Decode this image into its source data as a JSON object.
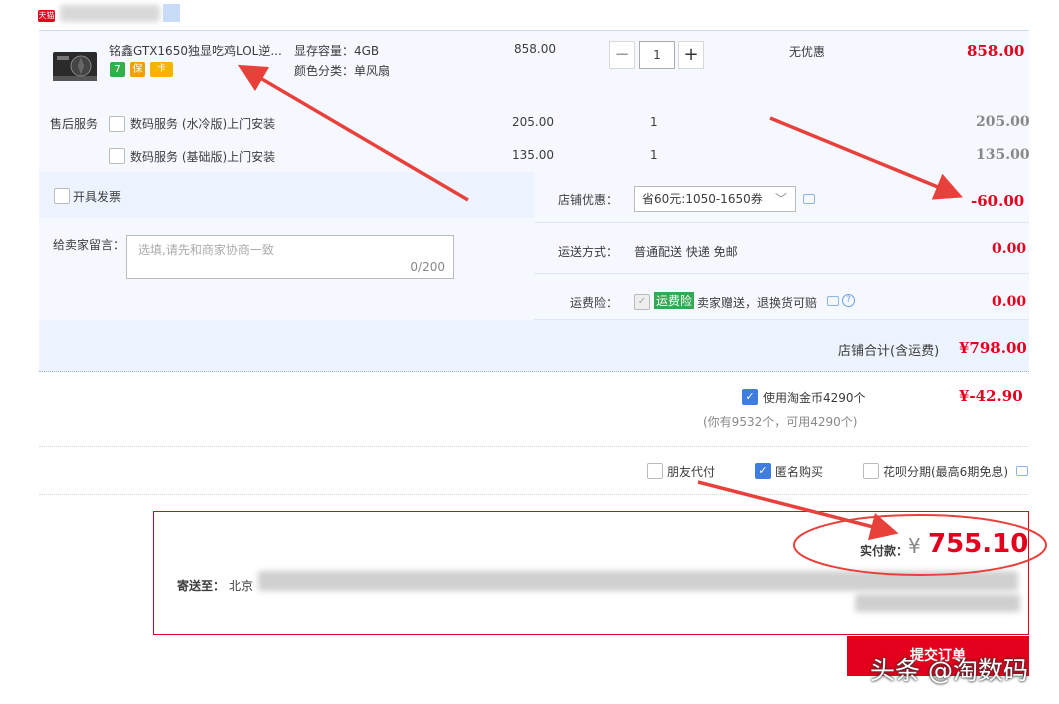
{
  "shop": {
    "badge": "天猫"
  },
  "product": {
    "title": "铭鑫GTX1650独显吃鸡LOL逆...",
    "spec_memory": "显存容量：4GB",
    "spec_color": "颜色分类：单风扇",
    "unit_price": "858.00",
    "quantity": "1",
    "discount": "无优惠",
    "subtotal": "858.00",
    "badges": [
      "7",
      "保",
      "卡"
    ]
  },
  "after_sales": {
    "label": "售后服务",
    "services": [
      {
        "name": "数码服务 (水冷版)上门安装",
        "price": "205.00",
        "qty": "1",
        "subtotal": "205.00"
      },
      {
        "name": "数码服务 (基础版)上门安装",
        "price": "135.00",
        "qty": "1",
        "subtotal": "135.00"
      }
    ]
  },
  "options": {
    "invoice_label": "开具发票",
    "memo_label": "给卖家留言：",
    "memo_placeholder": "选填,请先和商家协商一致",
    "memo_counter": "0/200",
    "store_discount_label": "店铺优惠：",
    "store_discount_value": "省60元:1050-1650券",
    "store_discount_amount": "-60.00",
    "shipping_label": "运送方式：",
    "shipping_value": "普通配送 快递 免邮",
    "shipping_amount": "0.00",
    "insurance_label": "运费险：",
    "insurance_tag": "运费险",
    "insurance_value": "卖家赠送，退换货可赔",
    "insurance_amount": "0.00"
  },
  "store_total": {
    "label": "店铺合计(含运费)",
    "value": "¥798.00"
  },
  "coins": {
    "label": "使用淘金币4290个",
    "note": "(你有9532个，可用4290个)",
    "amount": "¥-42.90"
  },
  "extras": {
    "friend_pay": "朋友代付",
    "anonymous": "匿名购买",
    "huabei": "花呗分期(最高6期免息)"
  },
  "payment": {
    "actual_label": "实付款：",
    "currency": "¥",
    "actual_amount": "755.10",
    "ship_to_label": "寄送至：",
    "ship_to_city": "北京",
    "submit": "提交订单"
  },
  "watermark": "头条 @淘数码",
  "colors": {
    "accent": "#e4001c",
    "link_blue": "#3f7de0",
    "arrow": "#e8413c"
  }
}
